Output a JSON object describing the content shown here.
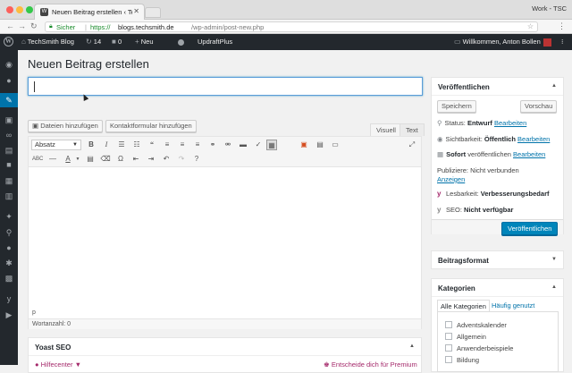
{
  "browser": {
    "tab_title": "Neuen Beitrag erstellen ‹ Tech",
    "tab_favicon": "wordpress-icon",
    "profile_name": "Work - TSC",
    "secure_label": "Sicher",
    "url_protocol": "https://",
    "url_host": "blogs.techsmith.de",
    "url_path": "/wp-admin/post-new.php"
  },
  "adminbar": {
    "site_name": "TechSmith Blog",
    "updates_count": "14",
    "comments_count": "0",
    "new_label": "Neu",
    "plugin_label": "UpdraftPlus",
    "greeting": "Willkommen, Anton Bollen"
  },
  "page": {
    "title": "Neuen Beitrag erstellen",
    "title_placeholder": ""
  },
  "media_buttons": {
    "add_media": "Dateien hinzufügen",
    "contact_form": "Kontaktformular hinzufügen"
  },
  "editor": {
    "tab_visual": "Visuell",
    "tab_text": "Text",
    "format_value": "Absatz",
    "path": "p",
    "word_count": "Wortanzahl: 0"
  },
  "yoast": {
    "title": "Yoast SEO",
    "help_center": "Hilfecenter",
    "premium_link": "Entscheide dich für Premium"
  },
  "publish": {
    "title": "Veröffentlichen",
    "save_label": "Speichern",
    "preview_label": "Vorschau",
    "status_label": "Status:",
    "status_value": "Entwurf",
    "edit_link": "Bearbeiten",
    "visibility_label": "Sichtbarkeit:",
    "visibility_value": "Öffentlich",
    "schedule_value": "Sofort",
    "schedule_suffix": "veröffentlichen",
    "publicize_label": "Publiziere: Nicht verbunden",
    "show_link": "Anzeigen",
    "readability_label": "Lesbarkeit:",
    "readability_value": "Verbesserungsbedarf",
    "seo_label": "SEO:",
    "seo_value": "Nicht verfügbar",
    "publish_button": "Veröffentlichen"
  },
  "format_box": {
    "title": "Beitragsformat"
  },
  "categories": {
    "title": "Kategorien",
    "tab_all": "Alle Kategorien",
    "tab_popular": "Häufig genutzt",
    "items": [
      "Adventskalender",
      "Allgemein",
      "Anwenderbeispiele",
      "Bildung"
    ]
  },
  "colors": {
    "adminbar": "#23282d",
    "accent": "#0073aa",
    "primary_button": "#0085ba"
  }
}
